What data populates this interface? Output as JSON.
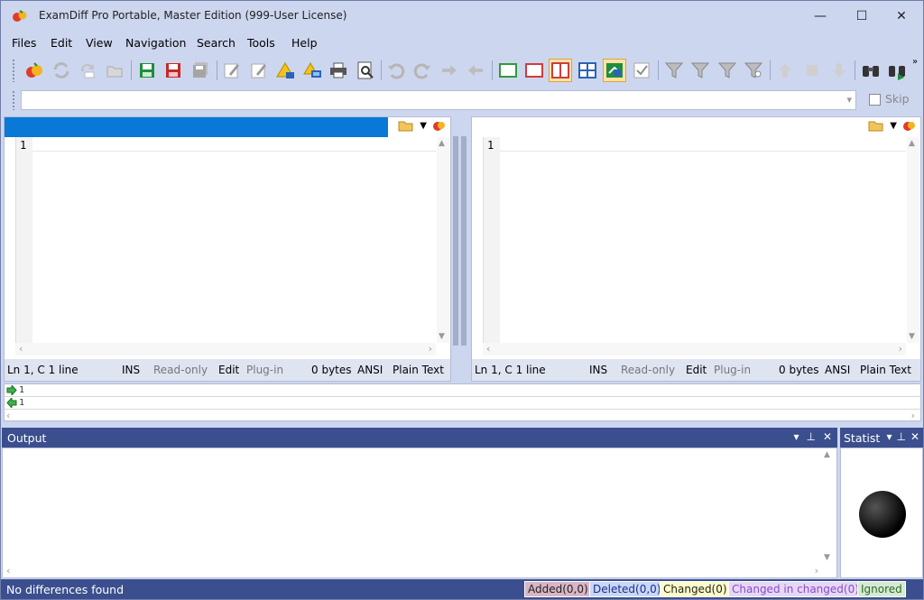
{
  "window": {
    "title": "ExamDiff Pro Portable, Master Edition (999-User License)",
    "minimize_glyph": "—",
    "maximize_glyph": "☐",
    "close_glyph": "✕"
  },
  "menu": [
    "Files",
    "Edit",
    "View",
    "Navigation",
    "Search",
    "Tools",
    "Help"
  ],
  "toolbar": {
    "icons": [
      "compare-icon",
      "recompare-icon",
      "swap-icon",
      "open-folder-icon",
      "save-left-icon",
      "save-right-icon",
      "save-all-icon",
      "edit-left-icon",
      "edit-right-icon",
      "warning-icon",
      "network-icon",
      "print-icon",
      "print-preview-icon",
      "undo-icon",
      "redo-icon",
      "copy-right-icon",
      "copy-left-icon",
      "show-left-icon",
      "show-right-icon",
      "side-by-side-icon",
      "grid-icon",
      "sync-icon",
      "checkbox-icon",
      "filter-icon",
      "filter-add-icon",
      "filter-remove-icon",
      "filter-search-icon",
      "prev-diff-icon",
      "stop-icon",
      "next-diff-icon",
      "find-icon",
      "find-next-icon"
    ],
    "more_glyph": "»"
  },
  "pathbar": {
    "value": "",
    "skip_label": "Skip"
  },
  "left_pane": {
    "line_number": "1",
    "status": {
      "position": "Ln 1, C 1 line",
      "ins": "INS",
      "readonly": "Read-only",
      "edit": "Edit",
      "plugin": "Plug-in",
      "size": "0 bytes",
      "encoding": "ANSI",
      "type": "Plain Text"
    }
  },
  "right_pane": {
    "line_number": "1",
    "status": {
      "position": "Ln 1, C 1 line",
      "ins": "INS",
      "readonly": "Read-only",
      "edit": "Edit",
      "plugin": "Plug-in",
      "size": "0 bytes",
      "encoding": "ANSI",
      "type": "Plain Text"
    }
  },
  "diff_strip": {
    "row1": "1",
    "row2": "1"
  },
  "output": {
    "title": "Output"
  },
  "stats": {
    "title": "Statist"
  },
  "statusbar": {
    "message": "No differences found",
    "legend": [
      {
        "label": "Added(0,0)",
        "bg": "#d8b6c6",
        "color": "#222"
      },
      {
        "label": "Deleted(0,0)",
        "bg": "#c9d6f5",
        "color": "#1a2f8a"
      },
      {
        "label": "Changed(0)",
        "bg": "#fffbc8",
        "color": "#222"
      },
      {
        "label": "Changed in changed(0)",
        "bg": "#e6d7f5",
        "color": "#8a4bc9"
      },
      {
        "label": "Ignored",
        "bg": "#d6ead2",
        "color": "#2d6a2d"
      }
    ]
  },
  "colors": {
    "accent": "#0a78d7",
    "panel_header": "#3b4f8e",
    "window_bg": "#cdd6ef"
  }
}
